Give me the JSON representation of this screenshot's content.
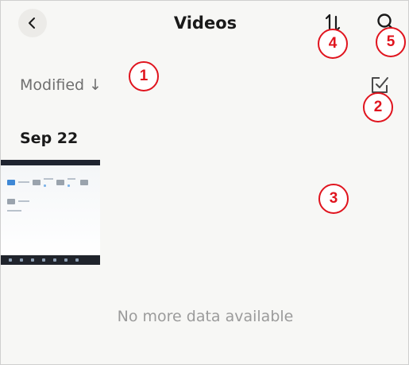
{
  "header": {
    "title": "Videos",
    "back_icon": "chevron-left-icon",
    "sort_icon": "sort-order-icon",
    "search_icon": "search-icon"
  },
  "toolbar": {
    "sort_label": "Modified ↓",
    "select_icon": "checkbox-select-icon"
  },
  "groups": [
    {
      "date": "Sep 22",
      "items": [
        {
          "type": "video",
          "thumbnail": "desktop-screenshot"
        }
      ]
    }
  ],
  "footer": {
    "empty_message": "No more data available"
  },
  "callouts": [
    "1",
    "2",
    "3",
    "4",
    "5"
  ],
  "colors": {
    "callout": "#e0141e",
    "background": "#f7f7f5",
    "title": "#1a1a1a",
    "muted": "#9b9b9b"
  }
}
